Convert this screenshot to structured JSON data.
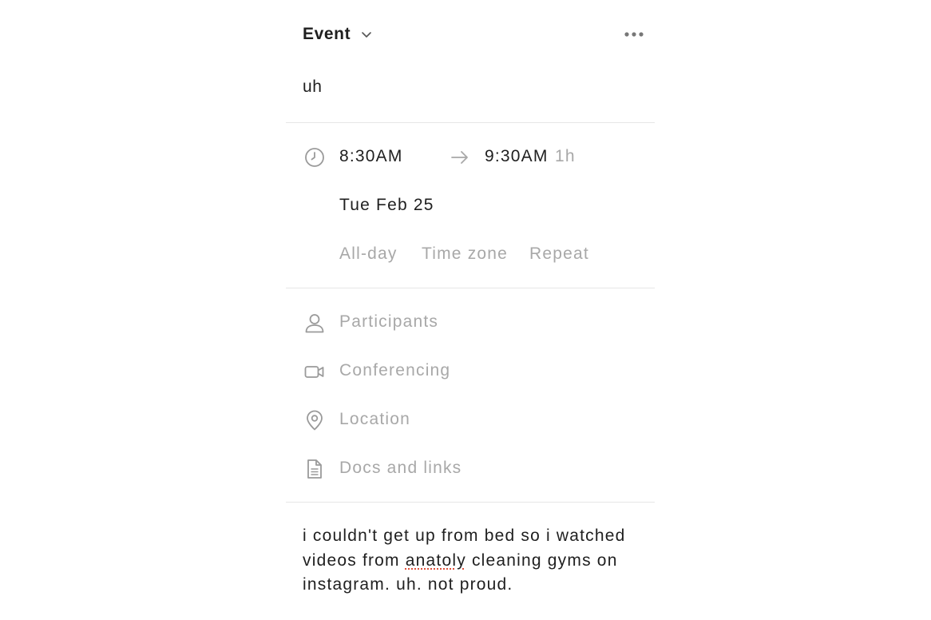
{
  "header": {
    "type_label": "Event"
  },
  "event": {
    "title": "uh",
    "start_time": "8:30AM",
    "end_time": "9:30AM",
    "duration": "1h",
    "date": "Tue Feb 25",
    "options": {
      "all_day": "All-day",
      "time_zone": "Time zone",
      "repeat": "Repeat"
    }
  },
  "details": {
    "participants": "Participants",
    "conferencing": "Conferencing",
    "location": "Location",
    "docs": "Docs and links"
  },
  "notes": {
    "part1": "i couldn't get up from bed so i watched videos from ",
    "misspelled_word": "anatoly",
    "part2": " cleaning gyms on instagram. uh. not proud."
  },
  "icons": {
    "type_chevron": "chevron-down-icon",
    "more": "more-horizontal-icon",
    "time": "clock-icon",
    "arrow": "arrow-right-icon",
    "participants": "person-icon",
    "conferencing": "video-camera-icon",
    "location": "map-pin-icon",
    "docs": "document-icon"
  },
  "colors": {
    "text": "#1f1f1f",
    "muted": "#a8a8a8",
    "divider": "#e6e6e6",
    "spellcheck": "#e0513c"
  }
}
